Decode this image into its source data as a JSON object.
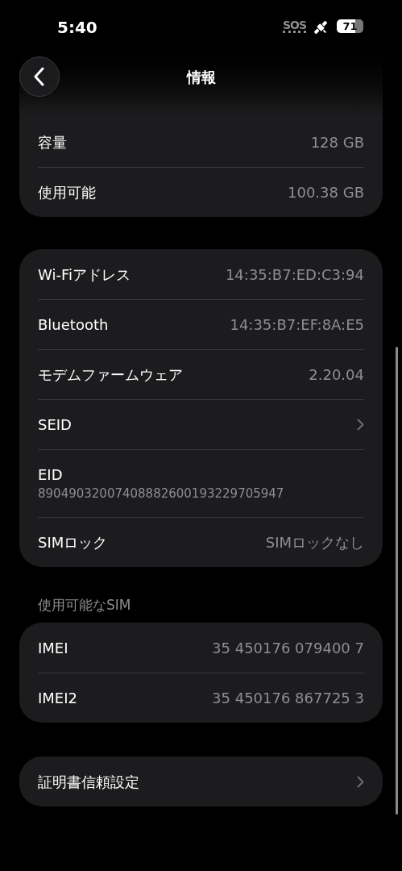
{
  "status_bar": {
    "time": "5:40",
    "sos": "SOS",
    "battery": "71"
  },
  "nav": {
    "title": "情報"
  },
  "groups": [
    {
      "rows": [
        {
          "kind": "value",
          "label": "容量",
          "value": "128 GB"
        },
        {
          "kind": "value",
          "label": "使用可能",
          "value": "100.38 GB"
        }
      ]
    },
    {
      "rows": [
        {
          "kind": "value",
          "label": "Wi-Fiアドレス",
          "value": "14:35:B7:ED:C3:94"
        },
        {
          "kind": "value",
          "label": "Bluetooth",
          "value": "14:35:B7:EF:8A:E5"
        },
        {
          "kind": "value",
          "label": "モデムファームウェア",
          "value": "2.20.04"
        },
        {
          "kind": "link",
          "label": "SEID"
        },
        {
          "kind": "stacked",
          "label": "EID",
          "value": "89049032007408882600193229705947"
        },
        {
          "kind": "value",
          "label": "SIMロック",
          "value": "SIMロックなし"
        }
      ]
    },
    {
      "header": "使用可能なSIM",
      "rows": [
        {
          "kind": "value",
          "label": "IMEI",
          "value": "35 450176 079400 7"
        },
        {
          "kind": "value",
          "label": "IMEI2",
          "value": "35 450176 867725 3"
        }
      ]
    },
    {
      "rows": [
        {
          "kind": "link",
          "label": "証明書信頼設定"
        }
      ]
    }
  ]
}
